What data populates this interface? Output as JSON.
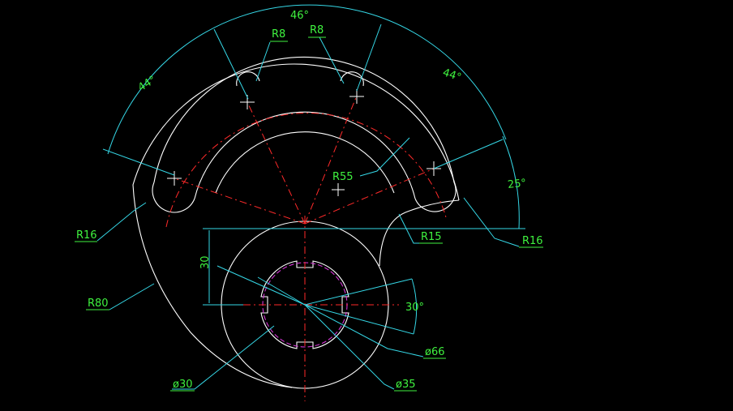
{
  "drawing": {
    "colors": {
      "background": "#000000",
      "outline": "#ffffff",
      "centerline": "#ff2a2a",
      "dimension_line": "#35d7e6",
      "dimension_text": "#3ff23f",
      "hidden_arc": "#d535d5"
    },
    "angular_dims": {
      "top": "46°",
      "left": "44°",
      "right": "44°",
      "right_small": "25°",
      "hub": "30°"
    },
    "radius_dims": {
      "r8_left": "R8",
      "r8_right": "R8",
      "r55": "R55",
      "r16_left": "R16",
      "r16_right": "R16",
      "r15": "R15",
      "r80": "R80"
    },
    "linear_dims": {
      "offset": "30"
    },
    "diameter_dims": {
      "d66": "ø66",
      "d35": "ø35",
      "d30": "ø30"
    }
  }
}
